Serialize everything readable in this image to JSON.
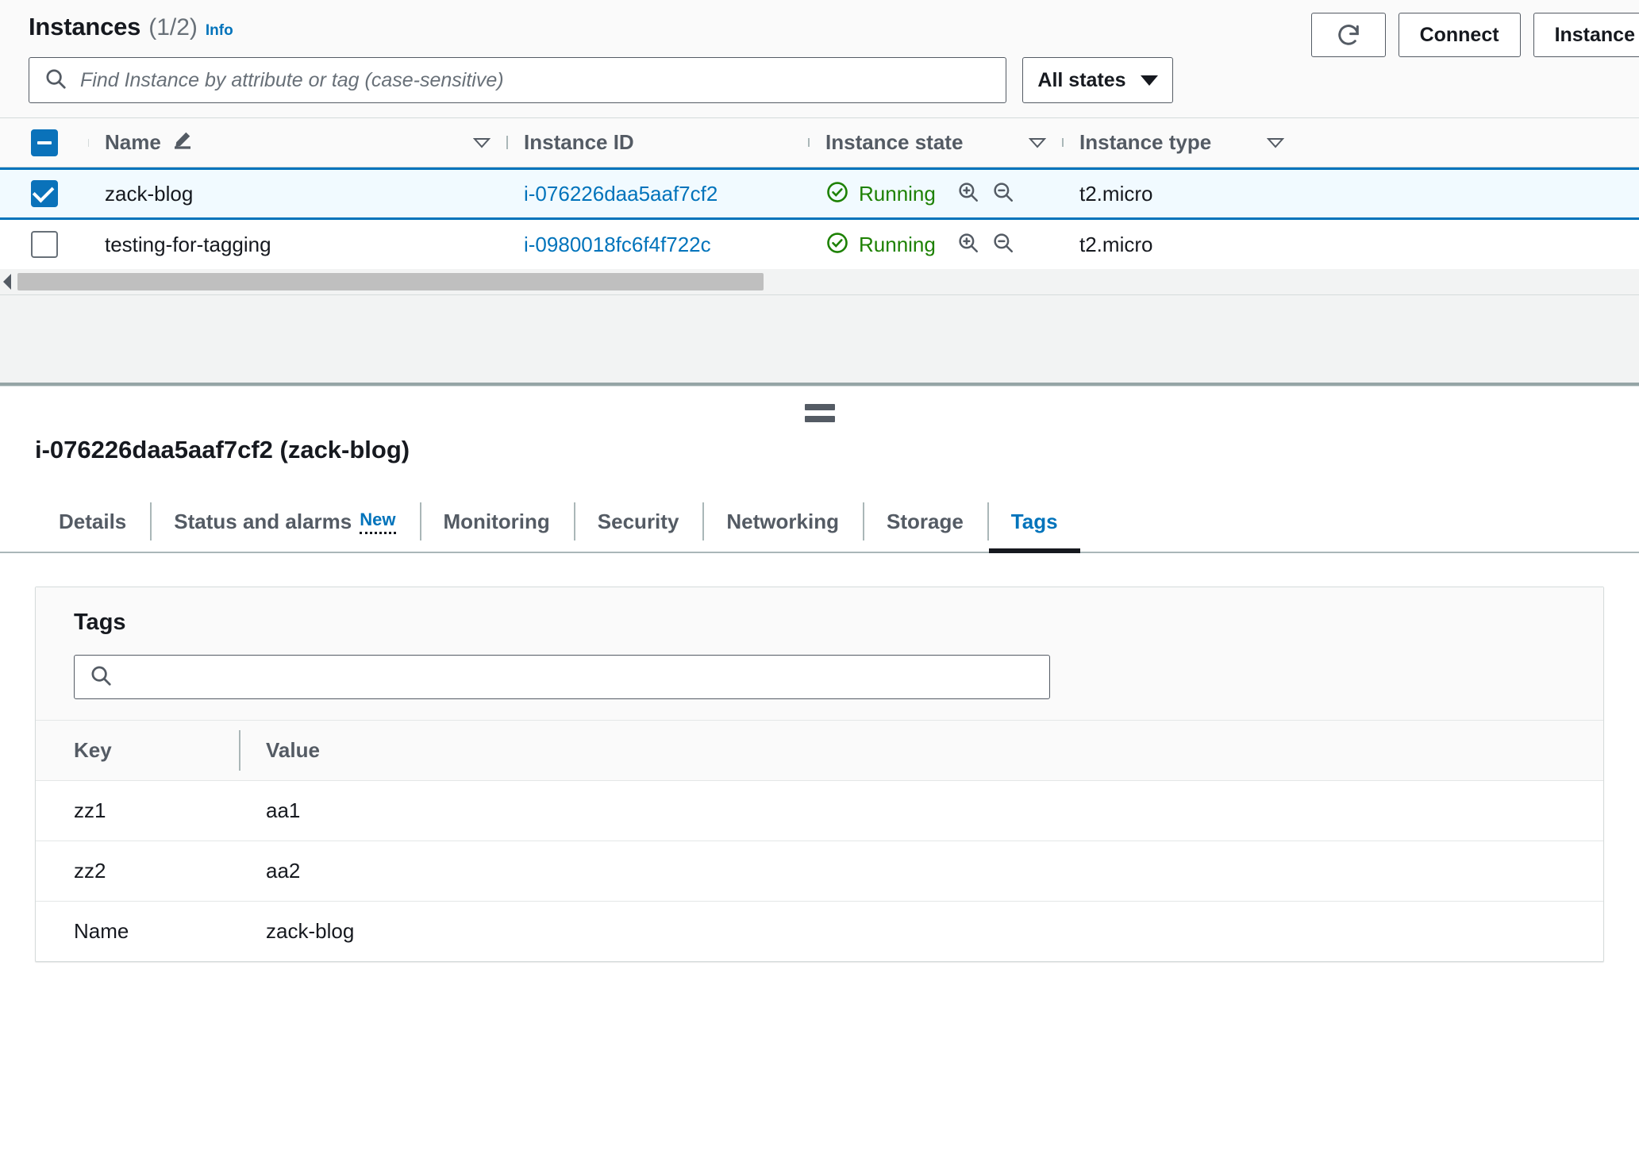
{
  "instances_panel": {
    "title": "Instances",
    "count": "(1/2)",
    "info_link": "Info",
    "buttons": {
      "refresh_icon": "refresh-icon",
      "connect": "Connect",
      "instance_state": "Instance"
    },
    "search": {
      "placeholder": "Find Instance by attribute or tag (case-sensitive)",
      "value": "",
      "icon": "search-icon"
    },
    "state_filter": {
      "label": "All states",
      "icon": "chevron-down-icon"
    },
    "columns": [
      {
        "label": "Name",
        "icon": "edit-pencil-icon",
        "sort": "sort-descending-icon"
      },
      {
        "label": "Instance ID",
        "sort": ""
      },
      {
        "label": "Instance state",
        "sort": "sort-descending-icon"
      },
      {
        "label": "Instance type",
        "sort": "sort-descending-icon"
      }
    ],
    "select_all_checkbox": "indeterminate",
    "rows": [
      {
        "selected": true,
        "checkbox": "checked",
        "name": "zack-blog",
        "instance_id": "i-076226daa5aaf7cf2",
        "state": "Running",
        "state_icon": "check-circle-icon",
        "zoom_in_icon": "zoom-in-icon",
        "zoom_out_icon": "zoom-out-icon",
        "instance_type": "t2.micro"
      },
      {
        "selected": false,
        "checkbox": "empty",
        "name": "testing-for-tagging",
        "instance_id": "i-0980018fc6f4f722c",
        "state": "Running",
        "state_icon": "check-circle-icon",
        "zoom_in_icon": "zoom-in-icon",
        "zoom_out_icon": "zoom-out-icon",
        "instance_type": "t2.micro"
      }
    ],
    "scrollbar": {
      "left_arrow_icon": "caret-left-icon"
    }
  },
  "detail_panel": {
    "drag_handle_icon": "drag-handle-icon",
    "title": "i-076226daa5aaf7cf2 (zack-blog)",
    "tabs": [
      {
        "label": "Details",
        "active": false,
        "badge": ""
      },
      {
        "label": "Status and alarms",
        "active": false,
        "badge": "New"
      },
      {
        "label": "Monitoring",
        "active": false,
        "badge": ""
      },
      {
        "label": "Security",
        "active": false,
        "badge": ""
      },
      {
        "label": "Networking",
        "active": false,
        "badge": ""
      },
      {
        "label": "Storage",
        "active": false,
        "badge": ""
      },
      {
        "label": "Tags",
        "active": true,
        "badge": ""
      }
    ],
    "tags_section": {
      "heading": "Tags",
      "search": {
        "placeholder": "",
        "value": "",
        "icon": "search-icon"
      },
      "columns": [
        "Key",
        "Value"
      ],
      "rows": [
        {
          "key": "zz1",
          "value": "aa1"
        },
        {
          "key": "zz2",
          "value": "aa2"
        },
        {
          "key": "Name",
          "value": "zack-blog"
        }
      ]
    }
  },
  "colors": {
    "accent_blue": "#0073bb",
    "checkbox_blue": "#0a72ba",
    "running_green": "#1d8102",
    "text_dark": "#16191f",
    "text_muted": "#545b64",
    "border": "#d5dbdb",
    "panel_bg": "#fafafa"
  }
}
